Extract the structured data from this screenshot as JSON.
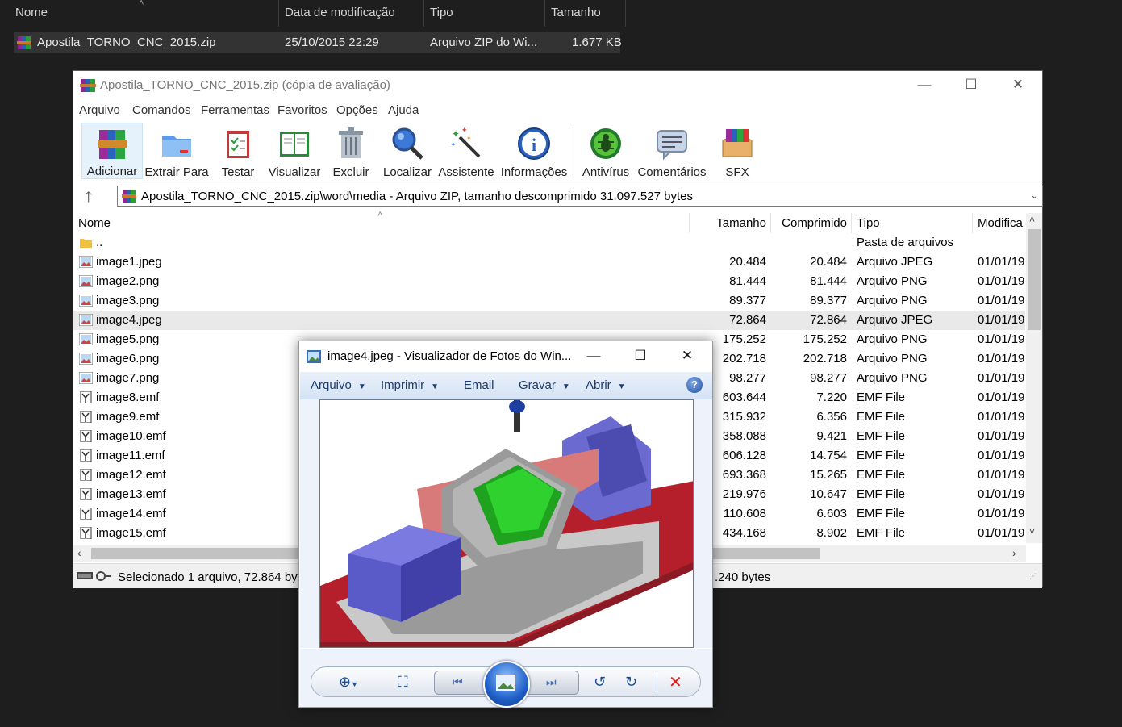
{
  "explorer": {
    "columns": {
      "name": "Nome",
      "modified": "Data de modificação",
      "type": "Tipo",
      "size": "Tamanho"
    },
    "row": {
      "name": "Apostila_TORNO_CNC_2015.zip",
      "modified": "25/10/2015 22:29",
      "type": "Arquivo ZIP do Wi...",
      "size": "1.677 KB"
    }
  },
  "winrar": {
    "title": "Apostila_TORNO_CNC_2015.zip (cópia de avaliação)",
    "menu": [
      "Arquivo",
      "Comandos",
      "Ferramentas",
      "Favoritos",
      "Opções",
      "Ajuda"
    ],
    "toolbar": [
      "Adicionar",
      "Extrair Para",
      "Testar",
      "Visualizar",
      "Excluir",
      "Localizar",
      "Assistente",
      "Informações",
      "Antivírus",
      "Comentários",
      "SFX"
    ],
    "address": "Apostila_TORNO_CNC_2015.zip\\word\\media - Arquivo ZIP, tamanho descomprimido 31.097.527 bytes",
    "columns": {
      "name": "Nome",
      "size": "Tamanho",
      "compressed": "Comprimido",
      "type": "Tipo",
      "modified": "Modifica"
    },
    "files": [
      {
        "name": "..",
        "size": "",
        "compressed": "",
        "type": "Pasta de arquivos",
        "modified": "",
        "icon": "folder-icon"
      },
      {
        "name": "image1.jpeg",
        "size": "20.484",
        "compressed": "20.484",
        "type": "Arquivo JPEG",
        "modified": "01/01/19",
        "icon": "image-icon"
      },
      {
        "name": "image2.png",
        "size": "81.444",
        "compressed": "81.444",
        "type": "Arquivo PNG",
        "modified": "01/01/19",
        "icon": "image-icon"
      },
      {
        "name": "image3.png",
        "size": "89.377",
        "compressed": "89.377",
        "type": "Arquivo PNG",
        "modified": "01/01/19",
        "icon": "image-icon"
      },
      {
        "name": "image4.jpeg",
        "size": "72.864",
        "compressed": "72.864",
        "type": "Arquivo JPEG",
        "modified": "01/01/19",
        "icon": "image-icon",
        "selected": true
      },
      {
        "name": "image5.png",
        "size": "175.252",
        "compressed": "175.252",
        "type": "Arquivo PNG",
        "modified": "01/01/19",
        "icon": "image-icon"
      },
      {
        "name": "image6.png",
        "size": "202.718",
        "compressed": "202.718",
        "type": "Arquivo PNG",
        "modified": "01/01/19",
        "icon": "image-icon"
      },
      {
        "name": "image7.png",
        "size": "98.277",
        "compressed": "98.277",
        "type": "Arquivo PNG",
        "modified": "01/01/19",
        "icon": "image-icon"
      },
      {
        "name": "image8.emf",
        "size": "603.644",
        "compressed": "7.220",
        "type": "EMF File",
        "modified": "01/01/19",
        "icon": "emf-icon"
      },
      {
        "name": "image9.emf",
        "size": "315.932",
        "compressed": "6.356",
        "type": "EMF File",
        "modified": "01/01/19",
        "icon": "emf-icon"
      },
      {
        "name": "image10.emf",
        "size": "358.088",
        "compressed": "9.421",
        "type": "EMF File",
        "modified": "01/01/19",
        "icon": "emf-icon"
      },
      {
        "name": "image11.emf",
        "size": "606.128",
        "compressed": "14.754",
        "type": "EMF File",
        "modified": "01/01/19",
        "icon": "emf-icon"
      },
      {
        "name": "image12.emf",
        "size": "693.368",
        "compressed": "15.265",
        "type": "EMF File",
        "modified": "01/01/19",
        "icon": "emf-icon"
      },
      {
        "name": "image13.emf",
        "size": "219.976",
        "compressed": "10.647",
        "type": "EMF File",
        "modified": "01/01/19",
        "icon": "emf-icon"
      },
      {
        "name": "image14.emf",
        "size": "110.608",
        "compressed": "6.603",
        "type": "EMF File",
        "modified": "01/01/19",
        "icon": "emf-icon"
      },
      {
        "name": "image15.emf",
        "size": "434.168",
        "compressed": "8.902",
        "type": "EMF File",
        "modified": "01/01/19",
        "icon": "emf-icon"
      }
    ],
    "status_left": "Selecionado 1 arquivo, 72.864 byt",
    "status_right": ".240 bytes"
  },
  "viewer": {
    "title": "image4.jpeg - Visualizador de Fotos do Win...",
    "menu": [
      "Arquivo",
      "Imprimir",
      "Email",
      "Gravar",
      "Abrir"
    ],
    "menu_has_dropdown": [
      true,
      true,
      false,
      true,
      true
    ]
  }
}
